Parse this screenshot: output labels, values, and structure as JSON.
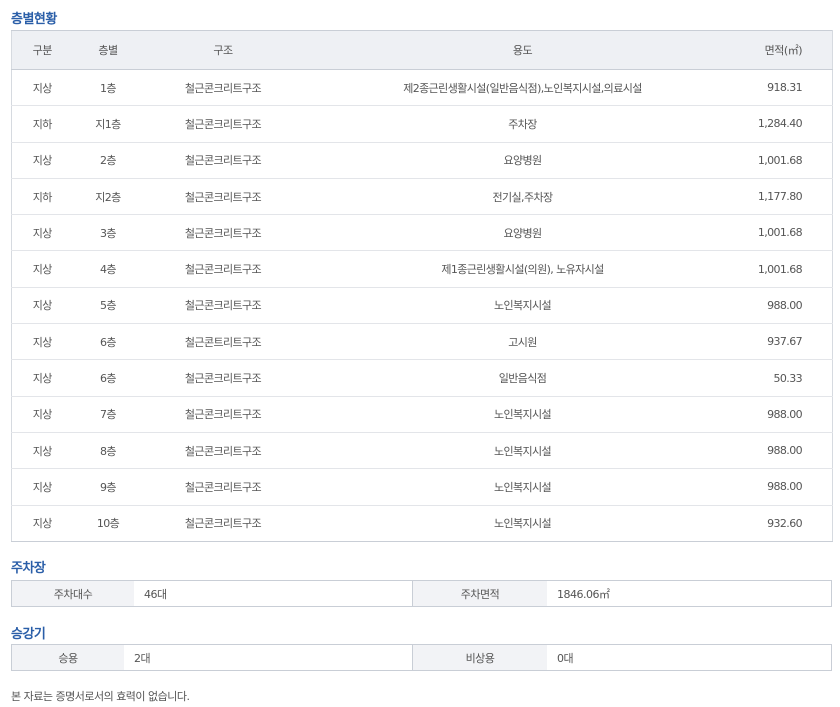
{
  "floor_section": {
    "title": "층별현황",
    "headers": [
      "구분",
      "층별",
      "구조",
      "용도",
      "면적(㎡)"
    ],
    "rows": [
      [
        "지상",
        "1층",
        "철근콘크리트구조",
        "제2종근린생활시설(일반음식점),노인복지시설,의료시설",
        "918.31"
      ],
      [
        "지하",
        "지1층",
        "철근콘크리트구조",
        "주차장",
        "1,284.40"
      ],
      [
        "지상",
        "2층",
        "철근콘크리트구조",
        "요양병원",
        "1,001.68"
      ],
      [
        "지하",
        "지2층",
        "철근콘크리트구조",
        "전기실,주차장",
        "1,177.80"
      ],
      [
        "지상",
        "3층",
        "철근콘크리트구조",
        "요양병원",
        "1,001.68"
      ],
      [
        "지상",
        "4층",
        "철근콘크리트구조",
        "제1종근린생활시설(의원), 노유자시설",
        "1,001.68"
      ],
      [
        "지상",
        "5층",
        "철근콘크리트구조",
        "노인복지시설",
        "988.00"
      ],
      [
        "지상",
        "6층",
        "철근콘트리트구조",
        "고시원",
        "937.67"
      ],
      [
        "지상",
        "6층",
        "철근콘크리트구조",
        "일반음식점",
        "50.33"
      ],
      [
        "지상",
        "7층",
        "철근콘크리트구조",
        "노인복지시설",
        "988.00"
      ],
      [
        "지상",
        "8층",
        "철근콘크리트구조",
        "노인복지시설",
        "988.00"
      ],
      [
        "지상",
        "9층",
        "철근콘크리트구조",
        "노인복지시설",
        "988.00"
      ],
      [
        "지상",
        "10층",
        "철근콘크리트구조",
        "노인복지시설",
        "932.60"
      ]
    ]
  },
  "parking": {
    "title": "주차장",
    "count_label": "주차대수",
    "count_value": "46대",
    "area_label": "주차면적",
    "area_value": "1846.06㎡"
  },
  "elevator": {
    "title": "승강기",
    "passenger_label": "승용",
    "passenger_value": "2대",
    "emergency_label": "비상용",
    "emergency_value": "0대"
  },
  "footnote": "본 자료는 증명서로서의 효력이 없습니다.",
  "colors": {
    "title_blue": "#2a5ea8",
    "header_bg": "#eef0f4",
    "border": "#c9ced6"
  }
}
